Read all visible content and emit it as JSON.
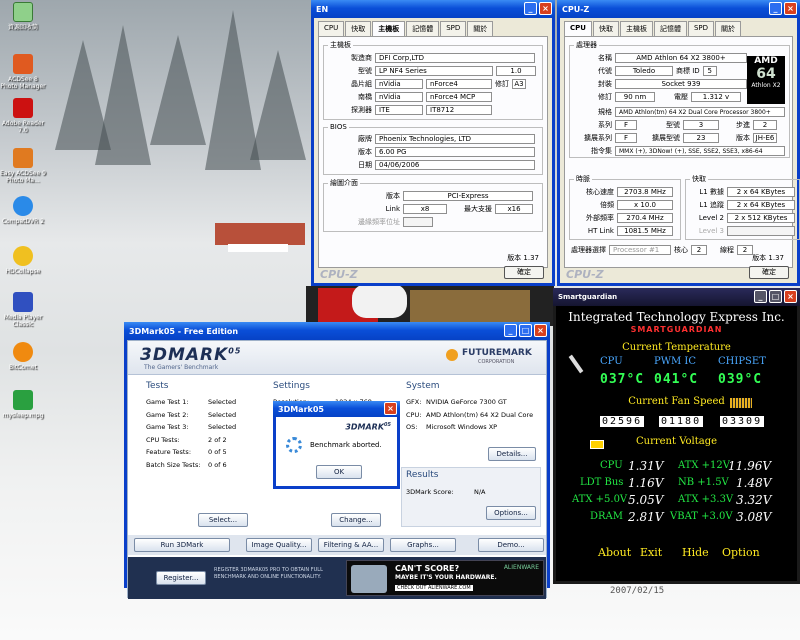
{
  "desktop": {
    "icons": [
      {
        "label": "資源回收筒",
        "icon": "recycle-bin-icon"
      },
      {
        "label": "ACDSee 8 Photo Manager",
        "icon": "acdsee-icon"
      },
      {
        "label": "Adobe Reader 7.0",
        "icon": "adobe-reader-icon"
      },
      {
        "label": "Easy ACDSee 9 Photo Ma...",
        "icon": "acdsee-icon"
      },
      {
        "label": "CompatDVR 2",
        "icon": "dvr-icon"
      },
      {
        "label": "HDCollapse",
        "icon": "app-icon"
      },
      {
        "label": "Media Player Classic",
        "icon": "media-player-icon"
      },
      {
        "label": "BitComet",
        "icon": "bitcomet-icon"
      },
      {
        "label": "mysleep.mpg",
        "icon": "video-file-icon"
      }
    ]
  },
  "cpuz_mb": {
    "title": "EN",
    "tabs": [
      "CPU",
      "快取",
      "主機板",
      "記憶體",
      "SPD",
      "關於"
    ],
    "active_tab": "主機板",
    "mb_legend": "主機板",
    "manufacturer_label": "製造商",
    "manufacturer": "DFI Corp,LTD",
    "model_label": "型號",
    "model": "LP NF4 Series",
    "model_rev": "1.0",
    "chipset_label": "晶片組",
    "chipset_vendor": "nVidia",
    "chipset": "nForce4",
    "rev_label": "修訂",
    "chipset_rev": "A3",
    "southbridge_label": "南橋",
    "sb_vendor": "nVidia",
    "southbridge": "nForce4 MCP",
    "sensor_label": "探測器",
    "sensor_vendor": "ITE",
    "sensor": "IT8712",
    "bios_legend": "BIOS",
    "bios_brand_label": "廠牌",
    "bios_brand": "Phoenix Technologies, LTD",
    "bios_version_label": "版本",
    "bios_version": "6.00 PG",
    "bios_date_label": "日期",
    "bios_date": "04/06/2006",
    "gfx_legend": "繪圖介面",
    "gfx_version_label": "版本",
    "gfx_version": "PCI-Express",
    "link_label": "Link",
    "link_width": "x8",
    "max_support_label": "最大支援",
    "max_support": "x16",
    "sideband_label": "邊緣頻率位址",
    "version": "版本 1.37",
    "ok": "確定",
    "brand": "CPU-Z"
  },
  "cpuz_cpu": {
    "title": "CPU-Z",
    "tabs": [
      "CPU",
      "快取",
      "主機板",
      "記憶體",
      "SPD",
      "關於"
    ],
    "active_tab": "CPU",
    "proc_legend": "處理器",
    "name_label": "名稱",
    "name": "AMD Athlon 64 X2 3800+",
    "code_label": "代號",
    "codename": "Toledo",
    "brand_id_label": "商標 ID",
    "brand_id": "5",
    "package_label": "封裝",
    "package": "Socket 939",
    "tech_label": "修訂",
    "technology": "90 nm",
    "voltage_label": "電壓",
    "voltage": "1.312 v",
    "spec_label": "規格",
    "spec": "AMD Athlon(tm) 64 X2 Dual Core Processor 3800+",
    "family_label": "系列",
    "family": "F",
    "model_label": "型號",
    "model": "3",
    "stepping_label": "步進",
    "stepping": "2",
    "ext_family_label": "擴展系列",
    "ext_family": "F",
    "ext_model_label": "擴展型號",
    "ext_model": "23",
    "revision_label": "版本",
    "revision": "JH-E6",
    "instr_label": "指令集",
    "instructions": "MMX (+), 3DNow! (+), SSE, SSE2, SSE3, x86-64",
    "clocks_legend": "時脈",
    "core_speed_label": "核心速度",
    "core_speed": "2703.8 MHz",
    "multiplier_label": "倍頻",
    "multiplier": "x 10.0",
    "bus_label": "外部頻率",
    "bus_speed": "270.4 MHz",
    "ht_label": "HT Link",
    "ht_link": "1081.5 MHz",
    "cache_legend": "快取",
    "l1d_label": "L1 數據",
    "l1d": "2 x 64 KBytes",
    "l1i_label": "L1 追蹤",
    "l1i": "2 x 64 KBytes",
    "l2_label": "Level 2",
    "l2": "2 x 512 KBytes",
    "l3_label": "Level 3",
    "l3": "",
    "selection_label": "處理器選擇",
    "selection": "Processor #1",
    "cores_label": "核心",
    "cores": "2",
    "threads_label": "線程",
    "threads": "2",
    "logo_top": "AMD",
    "logo_bottom": "Athlon X2",
    "logo_mid": "64",
    "version": "版本 1.37",
    "ok": "確定",
    "brand": "CPU-Z"
  },
  "dmark": {
    "title": "3DMark05 - Free Edition",
    "logo": "3DMARK",
    "logo_sup": "05",
    "tagline": "The Gamers' Benchmark",
    "fm_logo": "FUTUREMARK",
    "fm_sub": "CORPORATION",
    "tests_h": "Tests",
    "tests": [
      {
        "k": "Game Test 1:",
        "v": "Selected"
      },
      {
        "k": "Game Test 2:",
        "v": "Selected"
      },
      {
        "k": "Game Test 3:",
        "v": "Selected"
      },
      {
        "k": "CPU Tests:",
        "v": "2 of 2"
      },
      {
        "k": "Feature Tests:",
        "v": "0 of 5"
      },
      {
        "k": "Batch Size Tests:",
        "v": "0 of 6"
      }
    ],
    "settings_h": "Settings",
    "settings": [
      {
        "k": "Resolution:",
        "v": "1024 x 768"
      },
      {
        "k": "A",
        "v": ""
      },
      {
        "k": "F",
        "v": ""
      },
      {
        "k": "V",
        "v": ""
      },
      {
        "k": "F",
        "v": ""
      }
    ],
    "system_h": "System",
    "system": [
      {
        "k": "GFX:",
        "v": "NVIDIA GeForce 7300 GT"
      },
      {
        "k": "CPU:",
        "v": "AMD Athlon(tm) 64 X2 Dual Core"
      },
      {
        "k": "OS:",
        "v": "Microsoft Windows XP"
      }
    ],
    "results_h": "Results",
    "score_label": "3DMark Score:",
    "score": "N/A",
    "select_btn": "Select...",
    "change_btn": "Change...",
    "details_btn": "Details...",
    "options_btn": "Options...",
    "run_btn": "Run 3DMark",
    "iq_btn": "Image Quality...",
    "filter_btn": "Filtering & AA...",
    "graphs_btn": "Graphs...",
    "demo_btn": "Demo...",
    "register_btn": "Register...",
    "register_text": "REGISTER 3DMARK05 PRO TO OBTAIN FULL BENCHMARK AND ONLINE FUNCTIONALITY.",
    "ad_brand": "ALIENWARE",
    "ad_h1": "CAN'T SCORE?",
    "ad_h2": "MAYBE IT'S YOUR HARDWARE.",
    "ad_link": "CHECK OUT ALIENWARE.COM"
  },
  "dialog": {
    "title": "3DMark05",
    "logo": "3DMARK",
    "logo_sup": "05",
    "message": "Benchmark aborted.",
    "ok": "OK"
  },
  "sg": {
    "title": "Smartguardian",
    "company": "Integrated Technology Express Inc.",
    "product": "SMARTGUARDIAN",
    "temp_h": "Current Temperature",
    "temp_labels": [
      "CPU",
      "PWM IC",
      "CHIPSET"
    ],
    "temps": [
      "037°C",
      "041°C",
      "039°C"
    ],
    "fan_h": "Current Fan Speed",
    "fans": [
      "02596",
      "01180",
      "03309"
    ],
    "volt_h": "Current Voltage",
    "volts_left": [
      {
        "k": "CPU",
        "v": "1.31V"
      },
      {
        "k": "LDT Bus",
        "v": "1.16V"
      },
      {
        "k": "ATX +5.0V",
        "v": "5.05V"
      },
      {
        "k": "DRAM",
        "v": "2.81V"
      }
    ],
    "volts_right": [
      {
        "k": "ATX +12V",
        "v": "11.96V"
      },
      {
        "k": "NB +1.5V",
        "v": "1.48V"
      },
      {
        "k": "ATX +3.3V",
        "v": "3.32V"
      },
      {
        "k": "VBAT +3.0V",
        "v": "3.08V"
      }
    ],
    "menu": [
      "About",
      "Exit",
      "Hide",
      "Option"
    ]
  },
  "taskbar_text": "2007/02/15"
}
